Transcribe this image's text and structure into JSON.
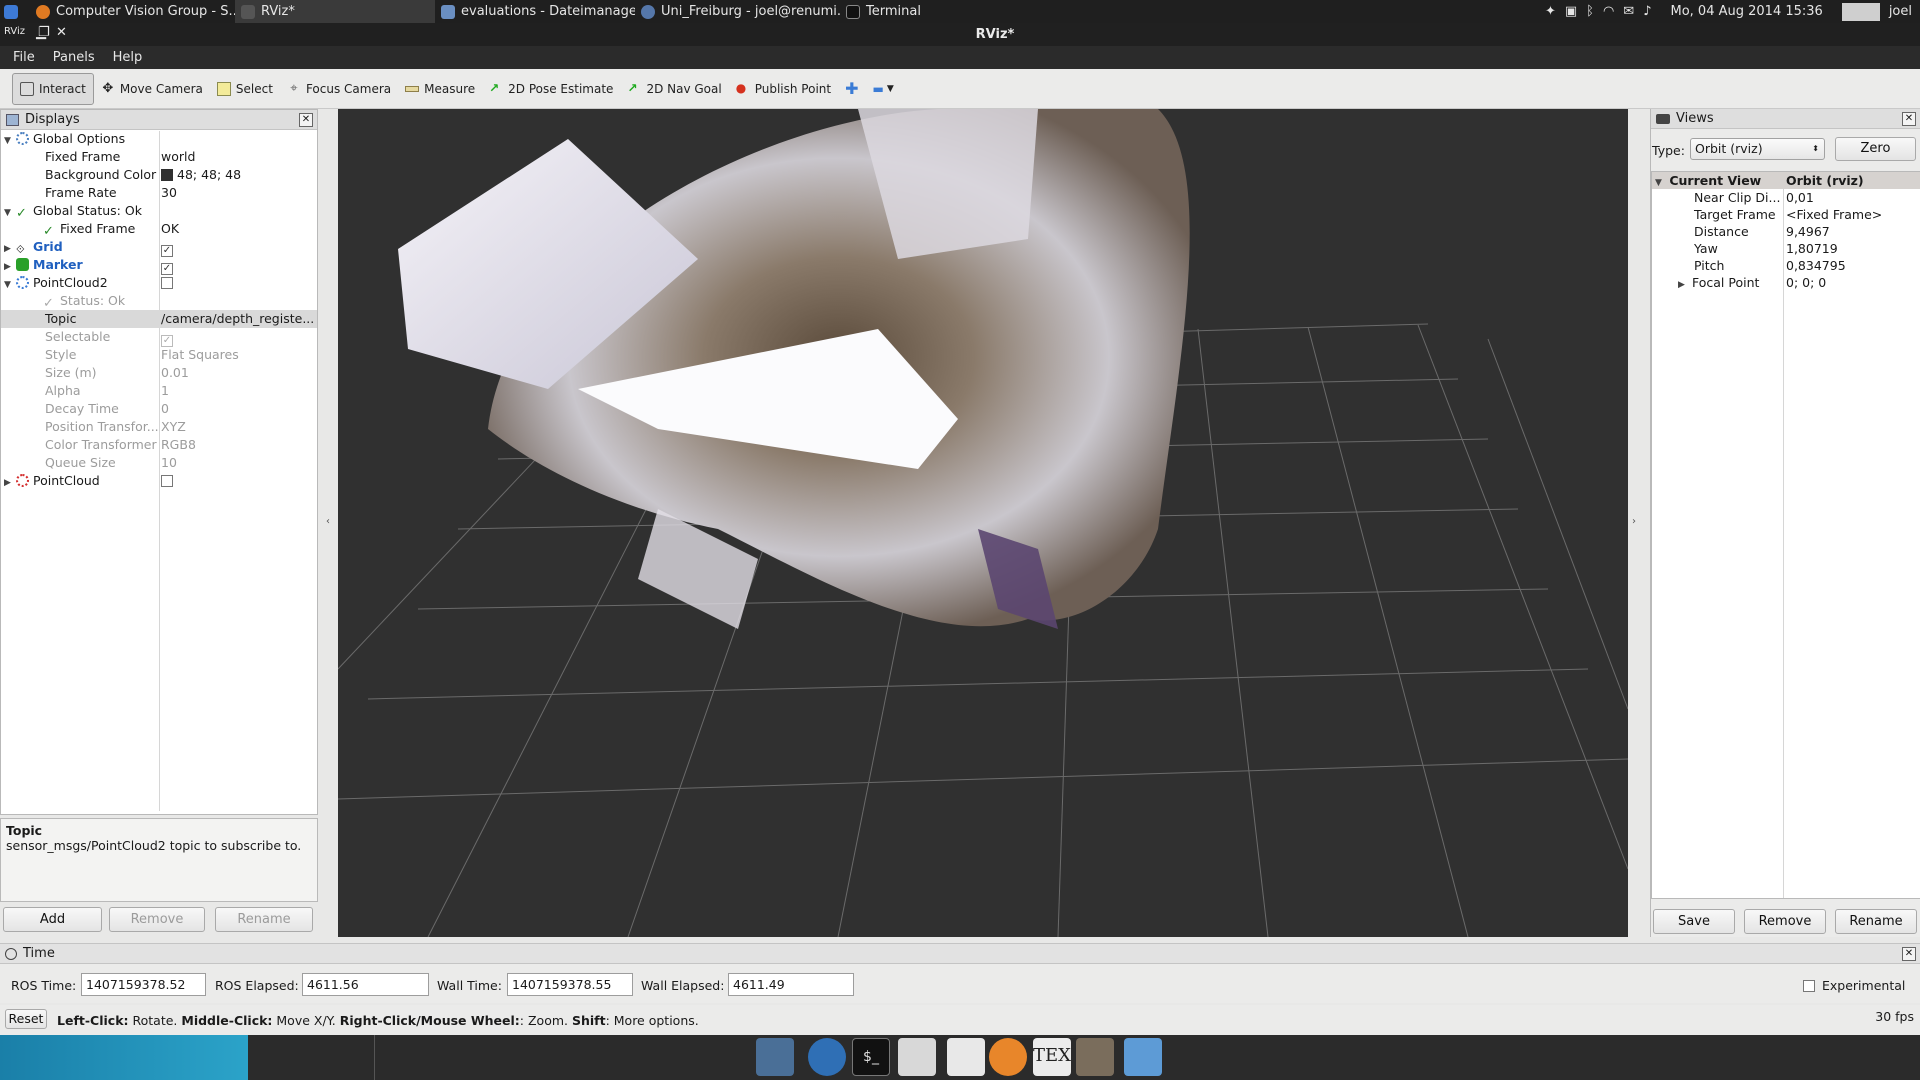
{
  "system_bar": {
    "tasks": [
      {
        "label": "Computer Vision Group - S..."
      },
      {
        "label": "RViz*"
      },
      {
        "label": "evaluations - Dateimanager"
      },
      {
        "label": "Uni_Freiburg - joel@renumi..."
      },
      {
        "label": "Terminal"
      }
    ],
    "datetime": "Mo, 04 Aug 2014 15:36",
    "user": "joel"
  },
  "window": {
    "title": "RViz*"
  },
  "menu": [
    "File",
    "Panels",
    "Help"
  ],
  "toolbar": [
    {
      "label": "Interact",
      "icon": "hand-cursor-icon"
    },
    {
      "label": "Move Camera",
      "icon": "move-arrows-icon"
    },
    {
      "label": "Select",
      "icon": "select-rectangle-icon"
    },
    {
      "label": "Focus Camera",
      "icon": "crosshair-icon"
    },
    {
      "label": "Measure",
      "icon": "ruler-icon"
    },
    {
      "label": "2D Pose Estimate",
      "icon": "green-arrow-icon"
    },
    {
      "label": "2D Nav Goal",
      "icon": "green-arrow-icon"
    },
    {
      "label": "Publish Point",
      "icon": "map-pin-icon"
    }
  ],
  "displays": {
    "title": "Displays",
    "rows": [
      {
        "key": "Global Options",
        "value": ""
      },
      {
        "key": "Fixed Frame",
        "value": "world"
      },
      {
        "key": "Background Color",
        "value": "48; 48; 48"
      },
      {
        "key": "Frame Rate",
        "value": "30"
      },
      {
        "key": "Global Status: Ok",
        "value": ""
      },
      {
        "key": "Fixed Frame",
        "value": "OK"
      },
      {
        "key": "Grid",
        "value": ""
      },
      {
        "key": "Marker",
        "value": ""
      },
      {
        "key": "PointCloud2",
        "value": ""
      },
      {
        "key": "Status: Ok",
        "value": ""
      },
      {
        "key": "Topic",
        "value": "/camera/depth_registe..."
      },
      {
        "key": "Selectable",
        "value": ""
      },
      {
        "key": "Style",
        "value": "Flat Squares"
      },
      {
        "key": "Size (m)",
        "value": "0.01"
      },
      {
        "key": "Alpha",
        "value": "1"
      },
      {
        "key": "Decay Time",
        "value": "0"
      },
      {
        "key": "Position Transfor...",
        "value": "XYZ"
      },
      {
        "key": "Color Transformer",
        "value": "RGB8"
      },
      {
        "key": "Queue Size",
        "value": "10"
      },
      {
        "key": "PointCloud",
        "value": ""
      }
    ],
    "description_title": "Topic",
    "description_text": "sensor_msgs/PointCloud2 topic to subscribe to.",
    "buttons": {
      "add": "Add",
      "remove": "Remove",
      "rename": "Rename"
    }
  },
  "views": {
    "title": "Views",
    "type_label": "Type:",
    "type_value": "Orbit (rviz)",
    "zero_button": "Zero",
    "rows": [
      {
        "key": "Current View",
        "value": "Orbit (rviz)"
      },
      {
        "key": "Near Clip Di...",
        "value": "0,01"
      },
      {
        "key": "Target Frame",
        "value": "<Fixed Frame>"
      },
      {
        "key": "Distance",
        "value": "9,4967"
      },
      {
        "key": "Yaw",
        "value": "1,80719"
      },
      {
        "key": "Pitch",
        "value": "0,834795"
      },
      {
        "key": "Focal Point",
        "value": "0; 0; 0"
      }
    ],
    "buttons": {
      "save": "Save",
      "remove": "Remove",
      "rename": "Rename"
    }
  },
  "time": {
    "title": "Time",
    "ros_time_label": "ROS Time:",
    "ros_time": "1407159378.52",
    "ros_elapsed_label": "ROS Elapsed:",
    "ros_elapsed": "4611.56",
    "wall_time_label": "Wall Time:",
    "wall_time": "1407159378.55",
    "wall_elapsed_label": "Wall Elapsed:",
    "wall_elapsed": "4611.49",
    "experimental_label": "Experimental"
  },
  "status": {
    "reset": "Reset",
    "hint_b1": "Left-Click:",
    "hint_t1": " Rotate. ",
    "hint_b2": "Middle-Click:",
    "hint_t2": " Move X/Y. ",
    "hint_b3": "Right-Click/Mouse Wheel:",
    "hint_t3": ": Zoom. ",
    "hint_b4": "Shift",
    "hint_t4": ": More options.",
    "fps": "30 fps"
  },
  "colors": {
    "viewport_bg": "#303030",
    "link_blue": "#1f5fbf",
    "ok_green": "#2a8a2a"
  }
}
